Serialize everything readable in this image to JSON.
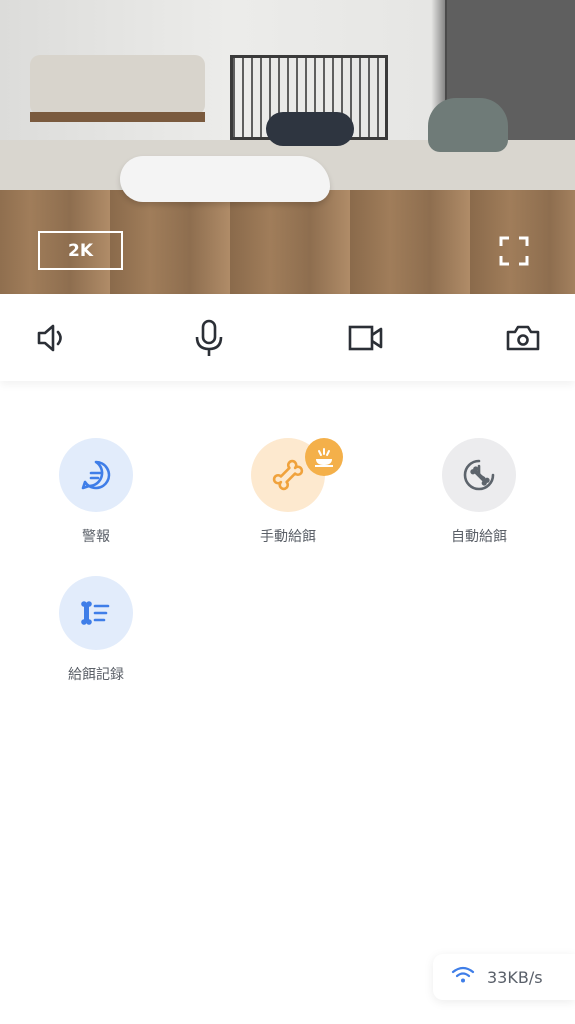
{
  "video": {
    "resolution_label": "2K"
  },
  "controls": [
    {
      "icon": "speaker-icon"
    },
    {
      "icon": "microphone-icon"
    },
    {
      "icon": "video-record-icon"
    },
    {
      "icon": "camera-icon"
    }
  ],
  "features": [
    {
      "label": "警報",
      "icon": "alert-message-icon"
    },
    {
      "label": "手動給餌",
      "icon": "bone-icon"
    },
    {
      "label": "自動給餌",
      "icon": "auto-feed-icon"
    },
    {
      "label": "給餌記録",
      "icon": "feed-log-icon"
    }
  ],
  "network": {
    "speed": "33KB/s",
    "icon": "wifi-icon"
  },
  "colors": {
    "alert_bg": "#e2ecfb",
    "alert_icon": "#3f7ee8",
    "feed_bg": "#fde9cf",
    "feed_icon": "#f0a23c",
    "auto_bg": "#ececee",
    "auto_icon": "#5d646c",
    "wifi": "#3f7ee8"
  }
}
